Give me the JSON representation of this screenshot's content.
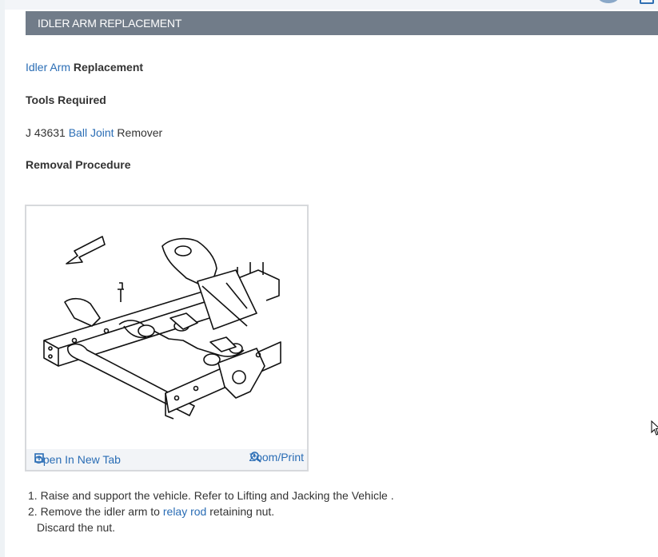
{
  "header": {
    "title": "IDLER ARM REPLACEMENT"
  },
  "content": {
    "heading_link": "Idler Arm",
    "heading_rest": " Replacement",
    "tools_required_label": "Tools Required",
    "tool_prefix": "J 43631 ",
    "tool_link": "Ball Joint",
    "tool_suffix": " Remover",
    "removal_procedure_label": "Removal Procedure"
  },
  "figure": {
    "open_new_tab_label": "Open In New Tab",
    "zoom_print_label": "Zoom/Print"
  },
  "steps": [
    {
      "number": "1.",
      "text": "Raise and support the vehicle. Refer to Lifting and Jacking the Vehicle ."
    },
    {
      "number": "2.",
      "text_before": "Remove the idler arm to ",
      "link": "relay rod",
      "text_after": " retaining nut.",
      "continuation": "Discard the nut."
    }
  ],
  "colors": {
    "title_bar": "#717c89",
    "link": "#2a6db5",
    "text": "#333333"
  },
  "icons": [
    "open-new-tab-icon",
    "zoom-icon",
    "mouse-pointer-icon"
  ]
}
